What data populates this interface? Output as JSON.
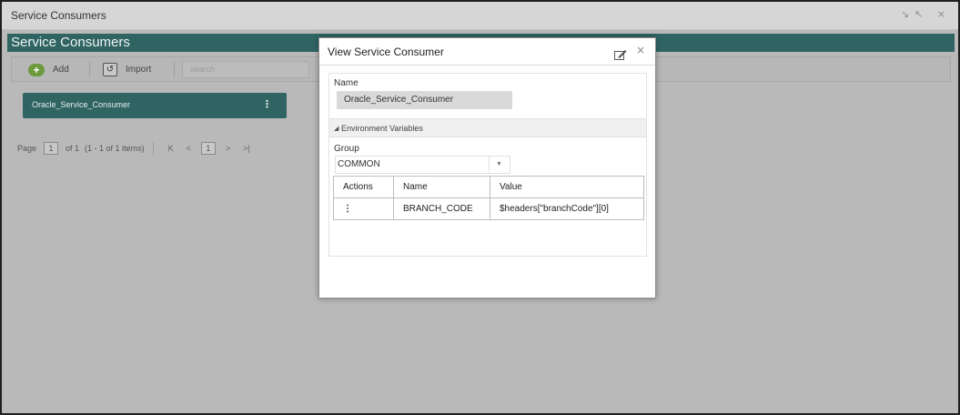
{
  "window": {
    "title": "Service Consumers",
    "controls": "↘↖ ×"
  },
  "header": {
    "title": "Service Consumers"
  },
  "toolbar": {
    "add_label": "Add",
    "import_label": "Import",
    "search_placeholder": "search"
  },
  "card": {
    "label": "Oracle_Service_Consumer",
    "menu": "⋮"
  },
  "pager": {
    "page_label": "Page",
    "current_page": "1",
    "of_label": "of 1",
    "items_label": "(1 - 1 of 1 items)",
    "first": "K",
    "prev": "<",
    "page_button": "1",
    "next": ">",
    "last": ">|"
  },
  "dialog": {
    "title": "View Service Consumer",
    "close": "×",
    "name_label": "Name",
    "name_value": "Oracle_Service_Consumer",
    "env_section": "Environment Variables",
    "group_label": "Group",
    "group_value": "COMMON",
    "columns": [
      "Actions",
      "Name",
      "Value"
    ],
    "rows": [
      {
        "action": "⋮",
        "name": "BRANCH_CODE",
        "value": "$headers[\"branchCode\"][0]"
      }
    ]
  },
  "colors": {
    "accent": "#2f6463",
    "add_green": "#6c9a3c",
    "overlay": "#b9b9b9"
  }
}
